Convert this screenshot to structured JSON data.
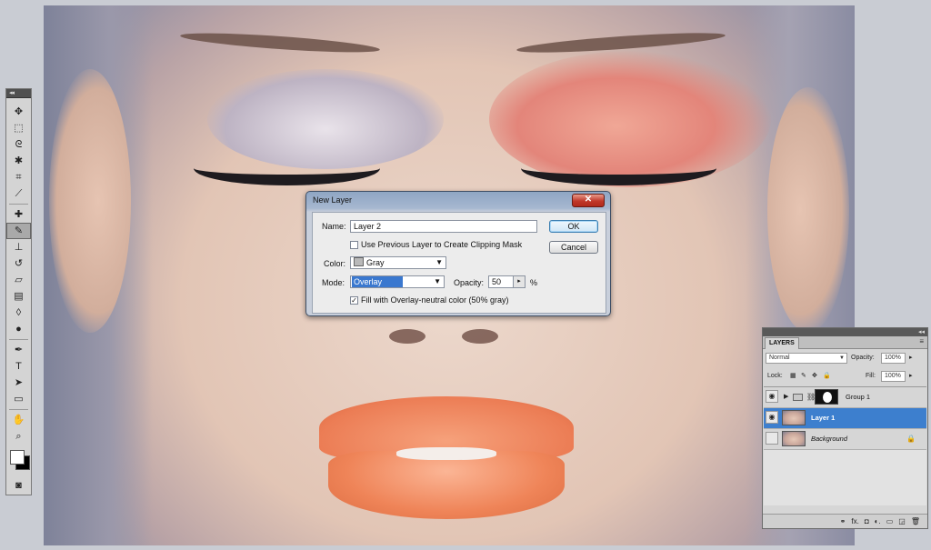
{
  "toolbox": {
    "collapse": "◂◂",
    "tools": [
      {
        "name": "move-tool-icon",
        "glyph": "✥"
      },
      {
        "name": "marquee-tool-icon",
        "glyph": "⬚"
      },
      {
        "name": "lasso-tool-icon",
        "glyph": "ᘓ"
      },
      {
        "name": "quick-select-tool-icon",
        "glyph": "✱"
      },
      {
        "name": "crop-tool-icon",
        "glyph": "⌗"
      },
      {
        "name": "eyedropper-tool-icon",
        "glyph": "⟋"
      },
      {
        "name": "healing-brush-tool-icon",
        "glyph": "✚"
      },
      {
        "name": "brush-tool-icon",
        "glyph": "✎"
      },
      {
        "name": "clone-stamp-tool-icon",
        "glyph": "⊥"
      },
      {
        "name": "history-brush-tool-icon",
        "glyph": "↺"
      },
      {
        "name": "eraser-tool-icon",
        "glyph": "▱"
      },
      {
        "name": "gradient-tool-icon",
        "glyph": "▤"
      },
      {
        "name": "blur-tool-icon",
        "glyph": "◊"
      },
      {
        "name": "dodge-tool-icon",
        "glyph": "●"
      },
      {
        "name": "pen-tool-icon",
        "glyph": "✒"
      },
      {
        "name": "type-tool-icon",
        "glyph": "T"
      },
      {
        "name": "path-selection-tool-icon",
        "glyph": "➤"
      },
      {
        "name": "shape-tool-icon",
        "glyph": "▭"
      },
      {
        "name": "hand-tool-icon",
        "glyph": "✋"
      },
      {
        "name": "zoom-tool-icon",
        "glyph": "⌕"
      }
    ],
    "quick_mask": "◙"
  },
  "dialog": {
    "title": "New Layer",
    "close_glyph": "✕",
    "name_label": "Name:",
    "name_value": "Layer 2",
    "clipping_label": "Use Previous Layer to Create Clipping Mask",
    "color_label": "Color:",
    "color_value": "Gray",
    "mode_label": "Mode:",
    "mode_value": "Overlay",
    "opacity_label": "Opacity:",
    "opacity_value": "50",
    "opacity_unit": "%",
    "fill_label": "Fill with Overlay-neutral color (50% gray)",
    "fill_checked": "✓",
    "ok_label": "OK",
    "cancel_label": "Cancel"
  },
  "layers_panel": {
    "collapse": "◂◂",
    "tab_label": "LAYERS",
    "menu_glyph": "≡",
    "blend_mode": "Normal",
    "opacity_label": "Opacity:",
    "opacity_value": "100%",
    "lock_label": "Lock:",
    "fill_label": "Fill:",
    "fill_value": "100%",
    "layers": [
      {
        "name": "Group 1"
      },
      {
        "name": "Layer 1"
      },
      {
        "name": "Background"
      }
    ],
    "footer_icons": [
      "⚭",
      "fx.",
      "◘",
      "◐.",
      "▭",
      "◲",
      "🗑"
    ]
  }
}
